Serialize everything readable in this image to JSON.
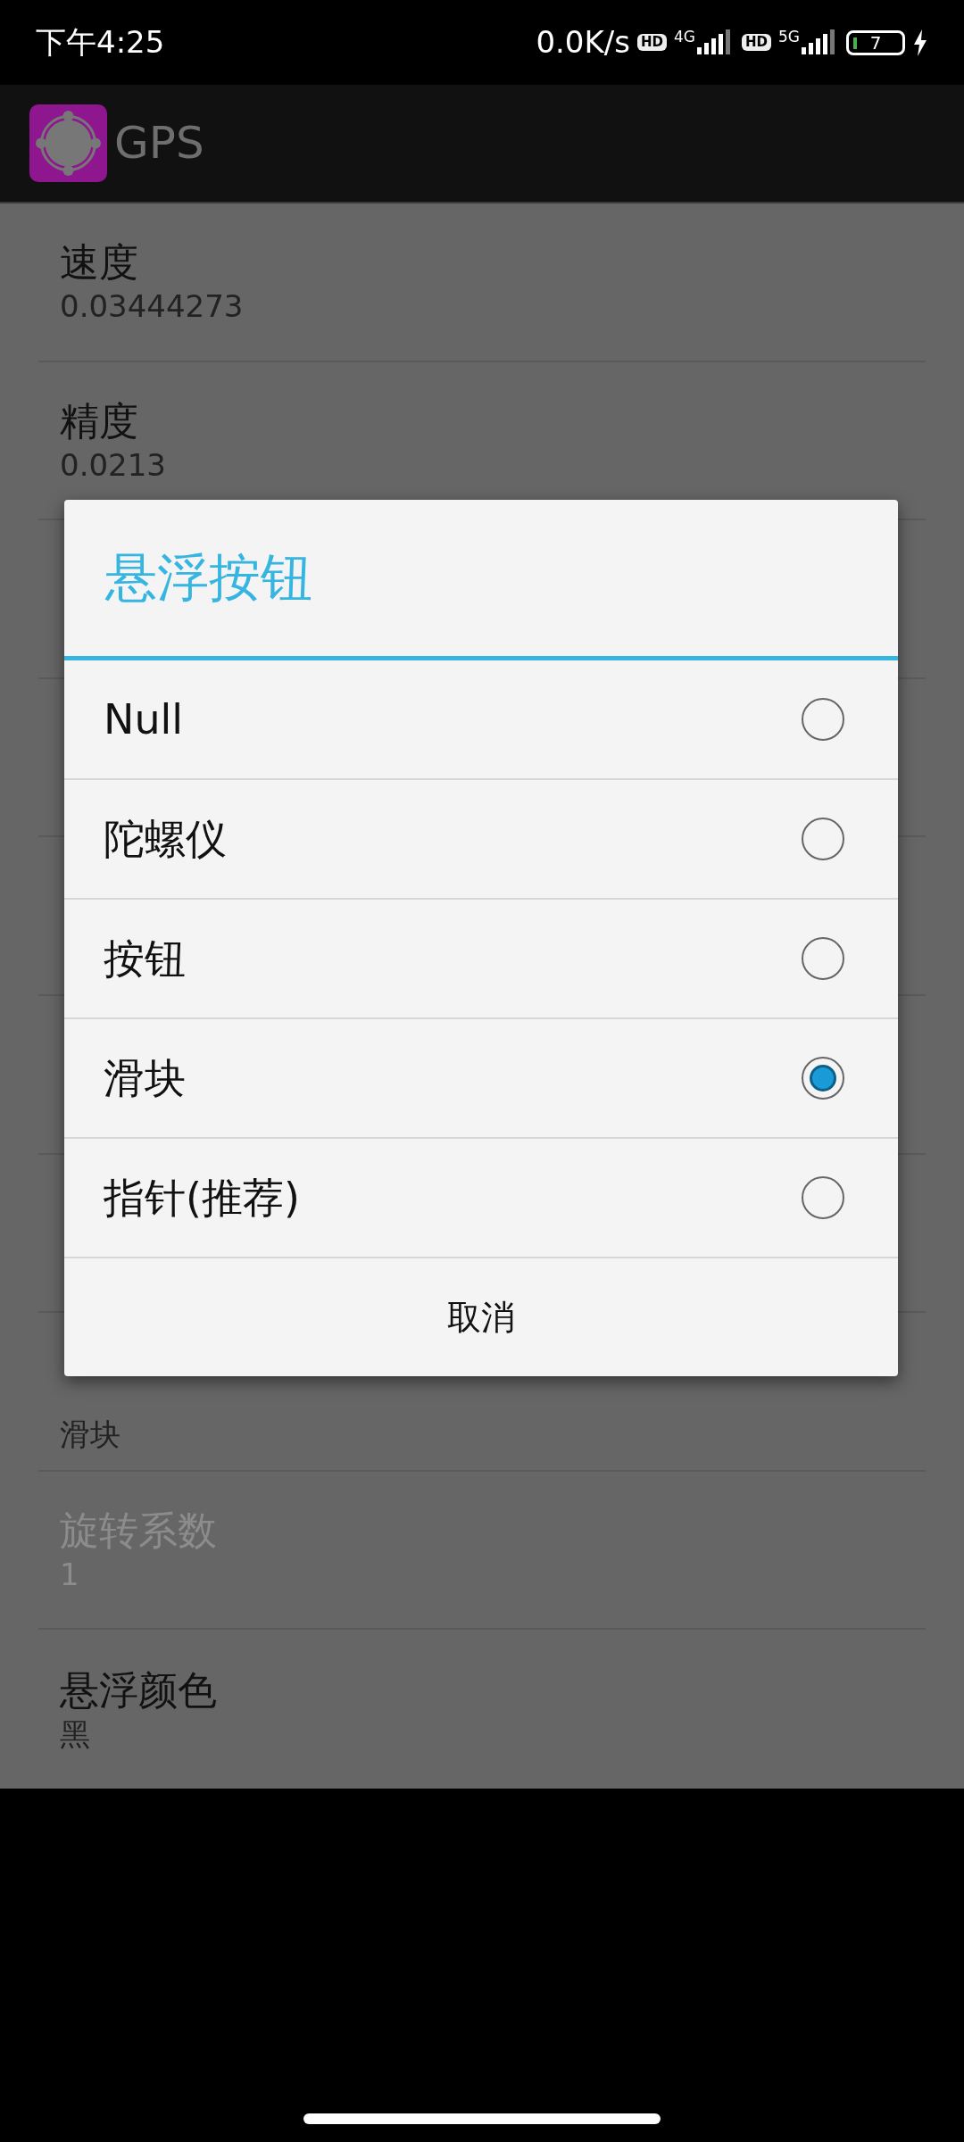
{
  "status_bar": {
    "time": "下午4:25",
    "net_speed": "0.0K/s",
    "sims": [
      {
        "hd": "HD",
        "network": "4G"
      },
      {
        "hd": "HD",
        "network": "5G"
      }
    ],
    "battery": "7",
    "charging": true
  },
  "app_bar": {
    "title": "GPS"
  },
  "settings": [
    {
      "kind": "row",
      "title": "速度",
      "summary": "0.03444273",
      "disabled": false
    },
    {
      "kind": "row",
      "title": "精度",
      "summary": "0.0213",
      "disabled": false
    },
    {
      "kind": "covered"
    },
    {
      "kind": "covered"
    },
    {
      "kind": "covered"
    },
    {
      "kind": "covered"
    },
    {
      "kind": "covered"
    },
    {
      "kind": "partial",
      "summary": "滑块"
    },
    {
      "kind": "row",
      "title": "旋转系数",
      "summary": "1",
      "disabled": true
    },
    {
      "kind": "row",
      "title": "悬浮颜色",
      "summary": "黑",
      "disabled": false
    }
  ],
  "dialog": {
    "title": "悬浮按钮",
    "options": [
      {
        "label": "Null",
        "selected": false
      },
      {
        "label": "陀螺仪",
        "selected": false
      },
      {
        "label": "按钮",
        "selected": false
      },
      {
        "label": "滑块",
        "selected": true
      },
      {
        "label": "指针(推荐)",
        "selected": false
      }
    ],
    "cancel": "取消"
  }
}
